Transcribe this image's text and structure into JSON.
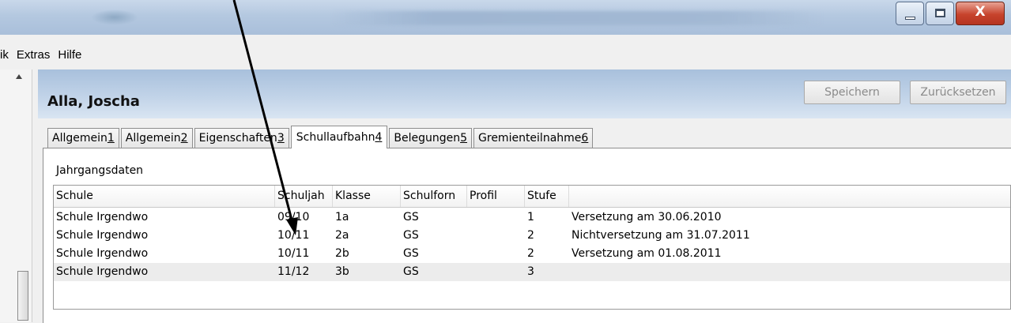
{
  "menu": [
    "ik",
    "Extras",
    "Hilfe"
  ],
  "header": {
    "student_name": "Alla, Joscha",
    "save_label": "Speichern",
    "reset_label": "Zurücksetzen"
  },
  "tabs": [
    {
      "label": "Allgemein ",
      "key": "1"
    },
    {
      "label": "Allgemein ",
      "key": "2"
    },
    {
      "label": "Eigenschaften ",
      "key": "3"
    },
    {
      "label": "Schullaufbahn ",
      "key": "4",
      "active": true
    },
    {
      "label": "Belegungen ",
      "key": "5"
    },
    {
      "label": "Gremienteilnahme ",
      "key": "6"
    }
  ],
  "section": {
    "label": "Jahrgangsdaten"
  },
  "table": {
    "columns": [
      "Schule",
      "Schuljah",
      "Klasse",
      "Schulforn",
      "Profil",
      "Stufe",
      ""
    ],
    "rows": [
      [
        "Schule Irgendwo",
        "09/10",
        "1a",
        "GS",
        "",
        "1",
        "Versetzung am 30.06.2010"
      ],
      [
        "Schule Irgendwo",
        "10/11",
        "2a",
        "GS",
        "",
        "2",
        "Nichtversetzung am 31.07.2011"
      ],
      [
        "Schule Irgendwo",
        "10/11",
        "2b",
        "GS",
        "",
        "2",
        "Versetzung am 01.08.2011"
      ],
      [
        "Schule Irgendwo",
        "11/12",
        "3b",
        "GS",
        "",
        "3",
        ""
      ]
    ],
    "selected_row": 3
  },
  "colors": {
    "header_gradient_top": "#a8c0dc",
    "close_button": "#c7432c",
    "disabled_text": "#8a8a8a"
  }
}
